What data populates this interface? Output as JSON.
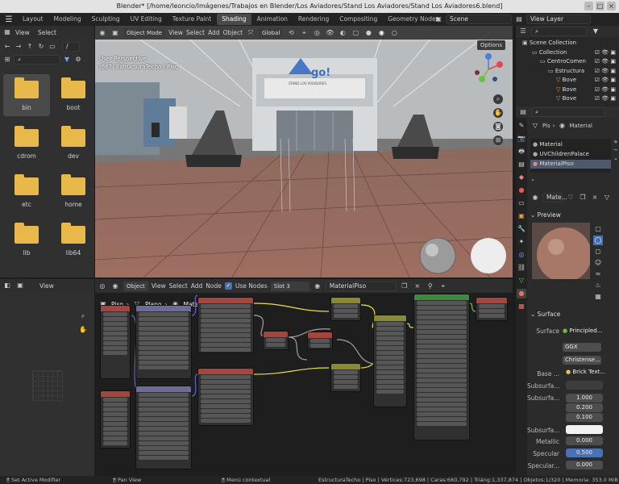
{
  "window": {
    "title": "Blender* [/home/leoncio/Imágenes/Trabajos en Blender/Los Aviadores/Stand Los Aviadores/Stand Los Aviadores6.blend]"
  },
  "workspaces": [
    "Layout",
    "Modeling",
    "Sculpting",
    "UV Editing",
    "Texture Paint",
    "Shading",
    "Animation",
    "Rendering",
    "Compositing",
    "Geometry Nodes",
    "Scripting"
  ],
  "active_workspace": "Shading",
  "scene": {
    "label": "Scene",
    "view_layer": "View Layer"
  },
  "filebrowser": {
    "menu": [
      "View",
      "Select"
    ],
    "path": "/",
    "folders": [
      "bin",
      "boot",
      "cdrom",
      "dev",
      "etc",
      "home",
      "lib",
      "lib64"
    ]
  },
  "viewport": {
    "mode": "Object Mode",
    "menu": [
      "View",
      "Select",
      "Add",
      "Object"
    ],
    "transform": "Global",
    "options": "Options",
    "info_line1": "User Perspective",
    "info_line2": "(667) EstructuraTecho | Piso",
    "logo_text": "go!",
    "logo_sub": "STAND LOS AVIADORES"
  },
  "outliner": {
    "rows": [
      "Scene Collection",
      "Collection",
      "CentroComen",
      "Estructura",
      "Bove",
      "Bove",
      "Bove"
    ]
  },
  "properties": {
    "breadcrumb_obj": "Pis",
    "breadcrumb_mat": "Material",
    "slots": [
      "Material",
      "UVChildrenPalace",
      "MaterialPiso"
    ],
    "material_name": "Mate...",
    "preview": "Preview",
    "surface_section": "Surface",
    "surface_label": "Surface",
    "surface_value": "Principled...",
    "distribution": "GGX",
    "subsurface_method": "Christense...",
    "base_label": "Base ...",
    "base_value": "Brick Text...",
    "subsurface": "Subsurfa...",
    "subsurface_radius_label": "Subsurfa...",
    "radius": [
      "1.000",
      "0.200",
      "0.100"
    ],
    "subsurface_color_label": "Subsurfa...",
    "metallic_label": "Metallic",
    "metallic": "0.000",
    "specular_label": "Specular",
    "specular": "0.500",
    "specular_tint_label": "Specular...",
    "specular_tint": "0.000"
  },
  "node_editor": {
    "mode": "Object",
    "menu": [
      "View",
      "Select",
      "Add",
      "Node"
    ],
    "use_nodes": "Use Nodes",
    "slot": "Slot 3",
    "material": "MaterialPiso",
    "breadcrumb": [
      "Piso",
      "Plano",
      "MaterialPiso"
    ]
  },
  "node_left_panel": {
    "view": "View"
  },
  "status": {
    "left": "Set Active Modifier",
    "mid1": "Pan View",
    "mid2": "Menú contextual",
    "right": "EstructuraTecho | Piso | Vértices:723,698 | Caras:660,792 | Triáng:1,337,874 | Objetos:1/320 | Memoria: 353.0 MiB | VRA"
  },
  "colors": {
    "accent": "#4772b3",
    "active_tab": "#4a4a4a",
    "folder": "#e8b84a"
  }
}
